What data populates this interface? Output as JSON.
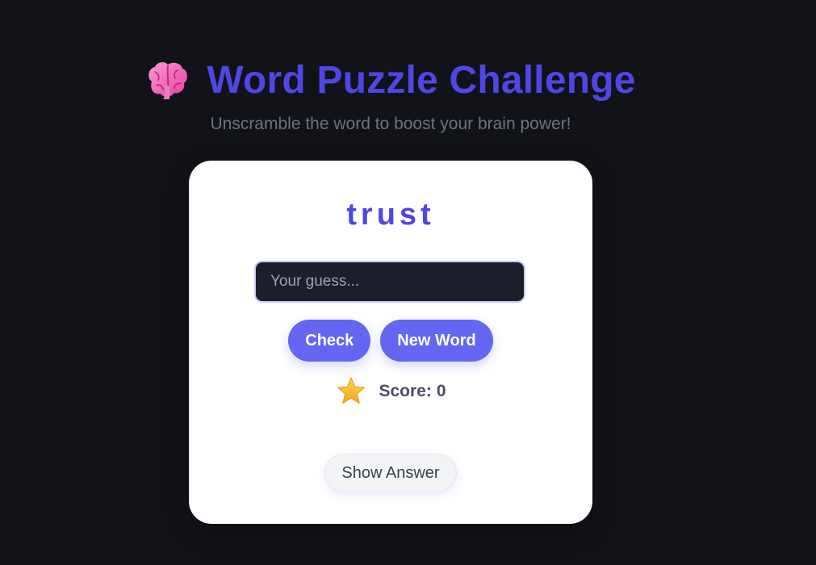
{
  "header": {
    "icon": "brain-icon",
    "title": "Word Puzzle Challenge",
    "subtitle": "Unscramble the word to boost your brain power!"
  },
  "puzzle": {
    "scrambled_word": "trust"
  },
  "guess_input": {
    "value": "",
    "placeholder": "Your guess..."
  },
  "buttons": {
    "check_label": "Check",
    "new_word_label": "New Word",
    "show_answer_label": "Show Answer"
  },
  "score": {
    "icon": "star-icon",
    "label": "Score:",
    "value": "0"
  },
  "colors": {
    "background": "#111318",
    "accent": "#4f46e5",
    "button": "#6366f1",
    "card": "#ffffff"
  }
}
